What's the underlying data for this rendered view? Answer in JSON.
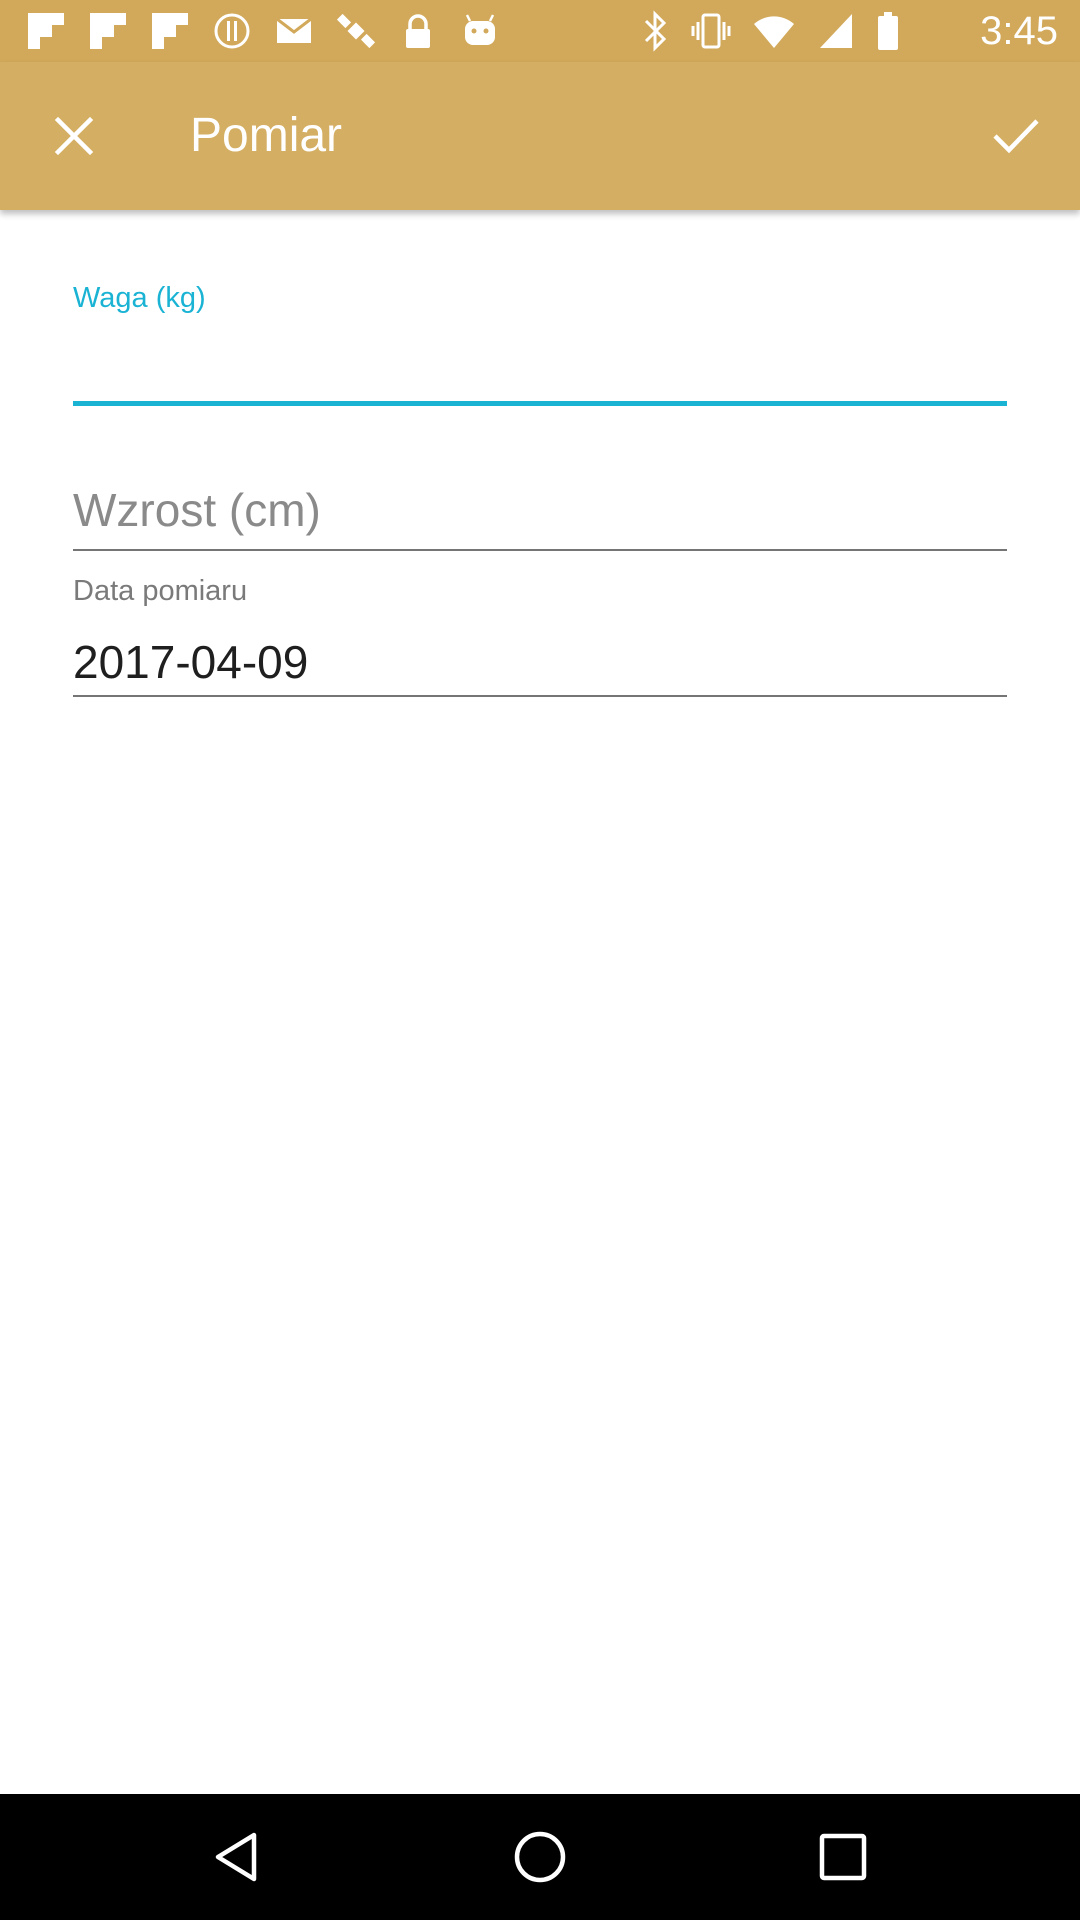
{
  "status_bar": {
    "time": "3:45",
    "left_icons": [
      "flipboard-icon",
      "flipboard-icon",
      "flipboard-icon",
      "alert-circle-icon",
      "mail-icon",
      "satellite-icon",
      "lock-icon",
      "android-icon"
    ],
    "right_icons": [
      "bluetooth-icon",
      "vibrate-icon",
      "wifi-icon",
      "signal-icon",
      "battery-icon"
    ]
  },
  "app_bar": {
    "title": "Pomiar",
    "close_icon": "close-icon",
    "confirm_icon": "check-icon",
    "background_color": "#d4ae62",
    "status_bar_color": "#d2a95a"
  },
  "form": {
    "weight": {
      "label": "Waga (kg)",
      "value": "",
      "accent_color": "#1ab3d4"
    },
    "height": {
      "placeholder": "Wzrost (cm)",
      "value": ""
    },
    "date": {
      "label": "Data pomiaru",
      "value": "2017-04-09"
    }
  },
  "nav_bar": {
    "back_icon": "back-triangle-icon",
    "home_icon": "home-circle-icon",
    "recents_icon": "recents-square-icon"
  }
}
